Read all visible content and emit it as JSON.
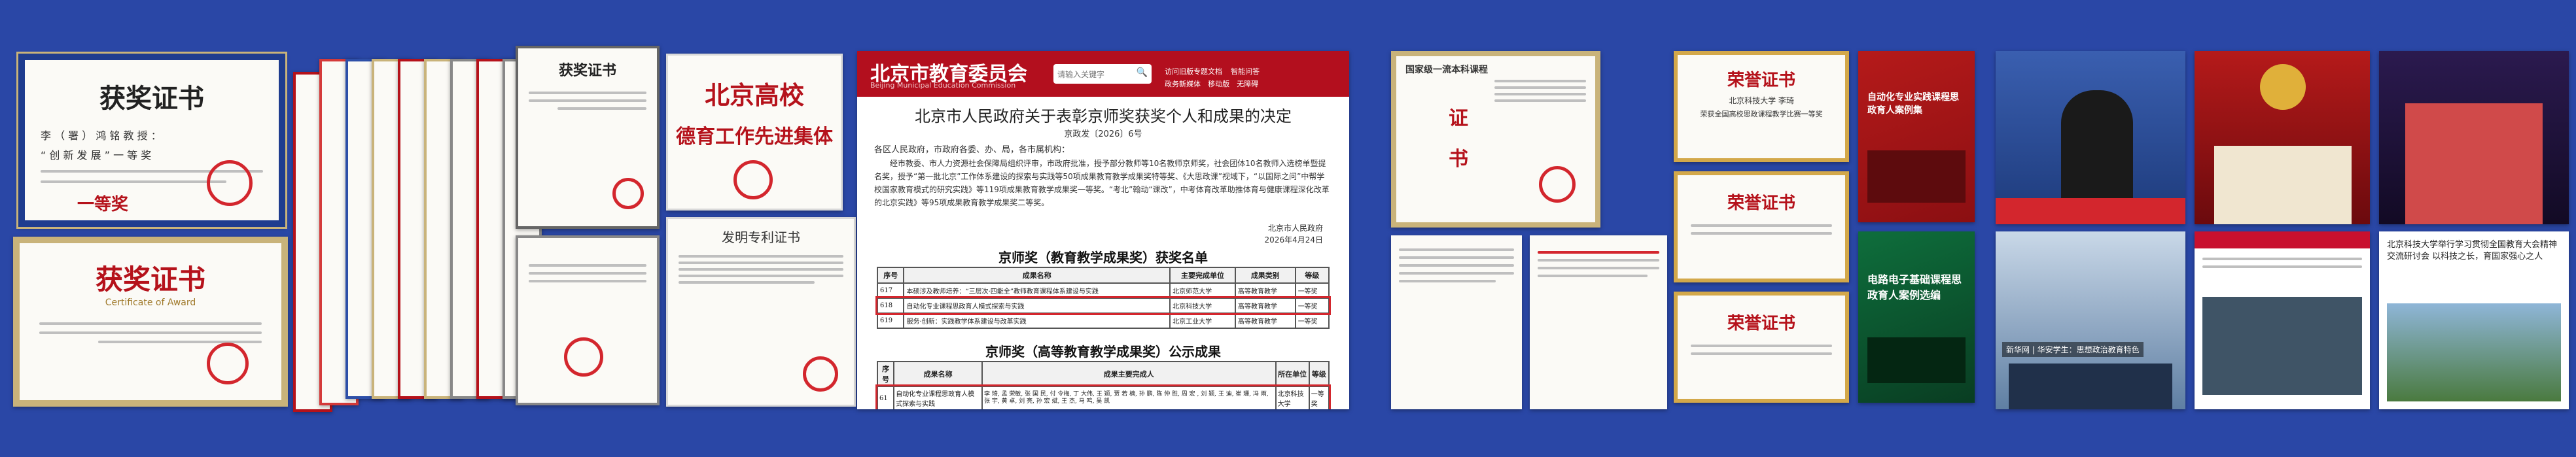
{
  "certificates": {
    "first": {
      "title": "获奖证书",
      "line1": "李 （ 署 ） 鸿 铭 教 授 ：",
      "line2": "“ 创 新 发 展 ” 一 等 奖",
      "level": "一等奖"
    },
    "second": {
      "title": "获奖证书",
      "subtitle": "Certificate of Award"
    },
    "third": {
      "title": "获奖证书"
    },
    "beijing_group": {
      "line1": "北京高校",
      "line2": "德育工作先进集体"
    },
    "patent_label": "发明专利证书"
  },
  "news": {
    "site_title": "北京市教育委员会",
    "site_subtitle": "Beijing Municipal Education Commission",
    "search_placeholder": "请输入关键字",
    "nav": [
      "访问旧版专题文档",
      "智能问答",
      "政务新媒体",
      "移动版",
      "无障碍"
    ],
    "headline": "北京市人民政府关于表彰京师奖获奖个人和成果的决定",
    "doc_no": "京政发〔2026〕6号",
    "recipients": "各区人民政府，市政府各委、办、局，各市属机构：",
    "body": "经市教委、市人力资源社会保障局组织评审，市政府批准，授予部分教师等10名教师京师奖，社会团体10名教师入选榜单暨提名奖，授予“第一批北京”工作体系建设的探索与实践等50项成果教育教学成果奖特等奖、《大思政课”视域下，“以国际之问”中帮学校国家教育模式的研究实践》等119项成果教育教学成果奖一等奖。“考北”翰动“课改”，中考体育改革助推体育与健康课程深化改革的北京实践》等95项成果教育教学成果奖二等奖。",
    "signature": "北京市人民政府",
    "date": "2026年4月24日",
    "table1_title": "京师奖（教育教学成果奖）获奖名单",
    "table1_headers": [
      "序号",
      "成果名称",
      "主要完成单位",
      "成果类别",
      "等级"
    ],
    "table1_rows": [
      [
        "617",
        "本硕涉及教师培养：“三层次·四能全”教师教育课程体系建设与实践",
        "北京师范大学",
        "高等教育教学",
        "一等奖"
      ],
      [
        "618",
        "自动化专业课程思政育人模式探索与实践",
        "北京科技大学",
        "高等教育教学",
        "一等奖"
      ],
      [
        "619",
        "服务·创新：实践教学体系建设与改革实践",
        "北京工业大学",
        "高等教育教学",
        "一等奖"
      ]
    ],
    "table2_title": "京师奖（高等教育教学成果奖）公示成果",
    "table2_headers": [
      "序号",
      "成果名称",
      "成果主要完成人",
      "所在单位",
      "等级"
    ],
    "table2_row": [
      "61",
      "自动化专业课程思政育人模式探索与实践",
      "李 琦, 孟 荣敏, 张 国 民, 付 令梅, 丁 大伟, 王 颖, 贾 若 楠, 孙 鹏, 陈 仲 胜, 周 宏 , 刘 颖, 王 迪, 崔 珊, 冯 雨, 张 宇, 黄 卓, 刘 亮, 孙 宏 斌, 王 杰, 马 鸣, 吴 凯",
      "北京科技大学",
      "一等奖"
    ]
  },
  "course_cert": {
    "heading": "国家级一流本科课程",
    "label1": "证",
    "label2": "书"
  },
  "honor": {
    "title": "荣誉证书",
    "subtitle": "北京科技大学 李琦",
    "body": "荣获全国高校思政课程教学比赛一等奖"
  },
  "books": {
    "book1": "自动化专业实践课程思政育人案例集",
    "book2": "电路电子基础课程思政育人案例选编"
  },
  "photos": {
    "caption": "新华网 | 华安学生：思想政治教育特色",
    "news_title": "北京科技大学举行学习贯彻全国教育大会精神交流研讨会 以科技之长，育国家强心之人"
  }
}
